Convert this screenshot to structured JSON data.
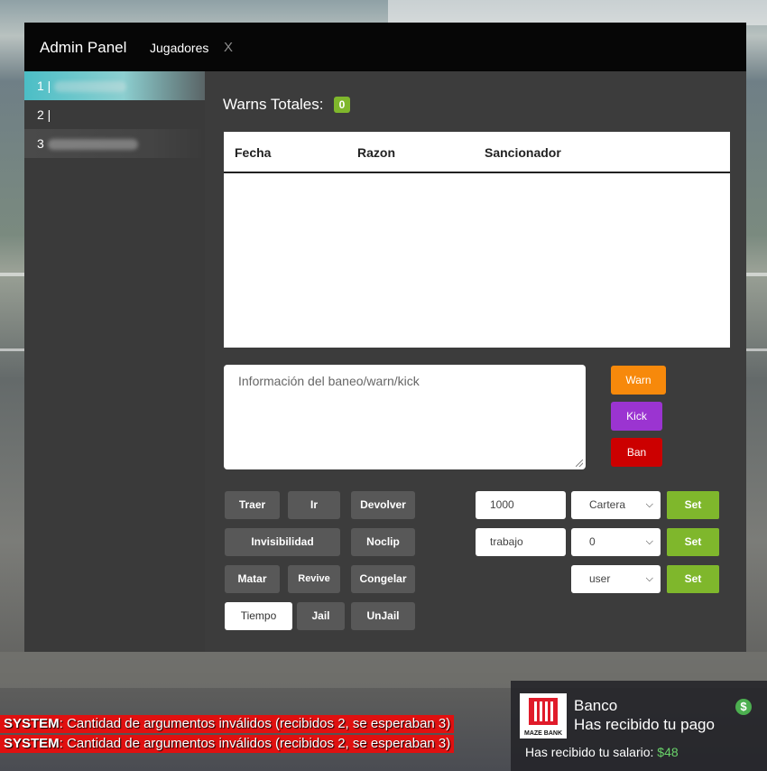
{
  "panel": {
    "title": "Admin Panel",
    "tabs": [
      {
        "label": "Jugadores"
      }
    ],
    "close_label": "X"
  },
  "players": [
    {
      "label": "1 |"
    },
    {
      "label": "2 |"
    },
    {
      "label": "3"
    }
  ],
  "warns": {
    "label": "Warns Totales:",
    "count": "0",
    "columns": [
      "Fecha",
      "Razon",
      "Sancionador"
    ],
    "rows": []
  },
  "reason_box": {
    "placeholder": "Información del baneo/warn/kick"
  },
  "sanctions": {
    "warn": "Warn",
    "kick": "Kick",
    "ban": "Ban"
  },
  "actions": {
    "traer": "Traer",
    "ir": "Ir",
    "devolver": "Devolver",
    "invisibilidad": "Invisibilidad",
    "noclip": "Noclip",
    "matar": "Matar",
    "revive": "Revive",
    "congelar": "Congelar",
    "tiempo": "Tiempo",
    "jail": "Jail",
    "unjail": "UnJail"
  },
  "money": {
    "amount": "1000",
    "account": "Cartera",
    "set": "Set"
  },
  "job": {
    "name": "trabajo",
    "grade": "0",
    "set": "Set"
  },
  "group": {
    "value": "user",
    "set": "Set"
  },
  "chat": [
    {
      "prefix": "SYSTEM",
      "text": ": Cantidad de argumentos inválidos (recibidos 2, se esperaban 3)"
    },
    {
      "prefix": "SYSTEM",
      "text": ": Cantidad de argumentos inválidos (recibidos 2, se esperaban 3)"
    }
  ],
  "notification": {
    "brand": "MAZE BANK",
    "title": "Banco",
    "subtitle": "Has recibido tu pago",
    "body": "Has recibido tu salario:",
    "amount": "$48",
    "icon": "$"
  },
  "colors": {
    "accent_green": "#7fb72c",
    "warn": "#f7890b",
    "kick": "#9b34d1",
    "ban": "#cc0000",
    "chat_red": "#e01010"
  }
}
